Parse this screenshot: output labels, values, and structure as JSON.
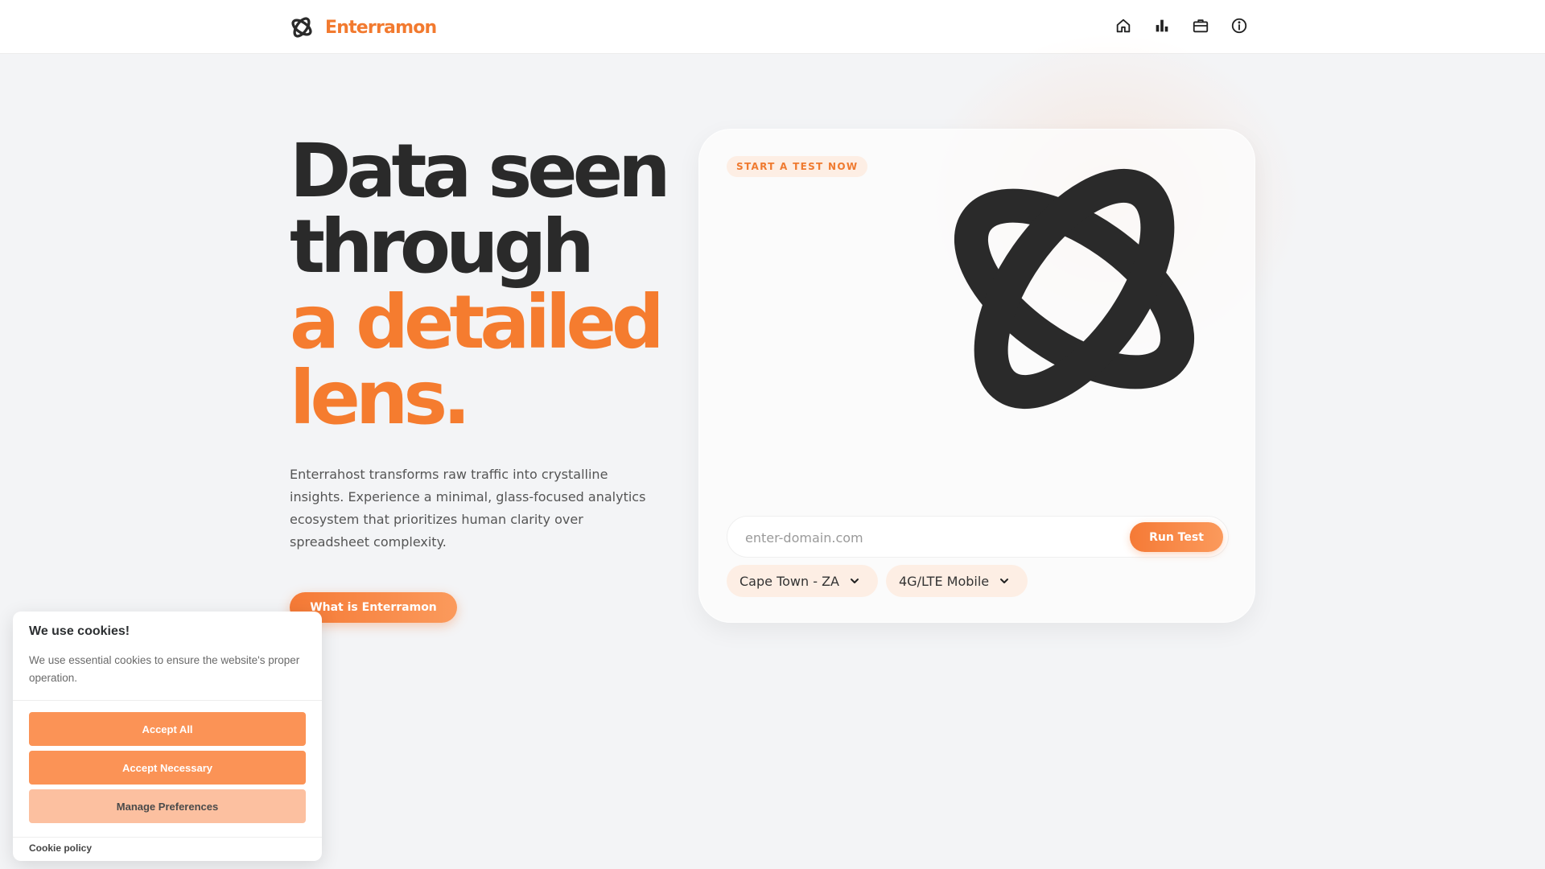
{
  "header": {
    "brand_name": "Enterramon",
    "nav": [
      {
        "icon": "home-icon"
      },
      {
        "icon": "bar-chart-icon"
      },
      {
        "icon": "briefcase-icon"
      },
      {
        "icon": "info-icon"
      }
    ]
  },
  "hero": {
    "title_line1": "Data seen",
    "title_line2": "through",
    "title_line3": "a detailed",
    "title_line4": "lens.",
    "description": "Enterrahost transforms raw traffic into crystalline insights. Experience a minimal, glass-focused analytics ecosystem that prioritizes human clarity over spreadsheet complexity.",
    "cta_label": "What is Enterramon"
  },
  "test_card": {
    "badge": "START A TEST NOW",
    "domain_placeholder": "enter-domain.com",
    "domain_value": "",
    "run_label": "Run Test",
    "location_selected": "Cape Town - ZA",
    "network_selected": "4G/LTE Mobile"
  },
  "cookie": {
    "title": "We use cookies!",
    "text": "We use essential cookies to ensure the website's proper operation.",
    "accept_all": "Accept All",
    "accept_necessary": "Accept Necessary",
    "manage": "Manage Preferences",
    "policy_link": "Cookie policy"
  },
  "colors": {
    "accent": "#f57c2f",
    "text_dark": "#2a2a2a",
    "background": "#f3f4f6",
    "badge_bg": "#fdeee4"
  }
}
